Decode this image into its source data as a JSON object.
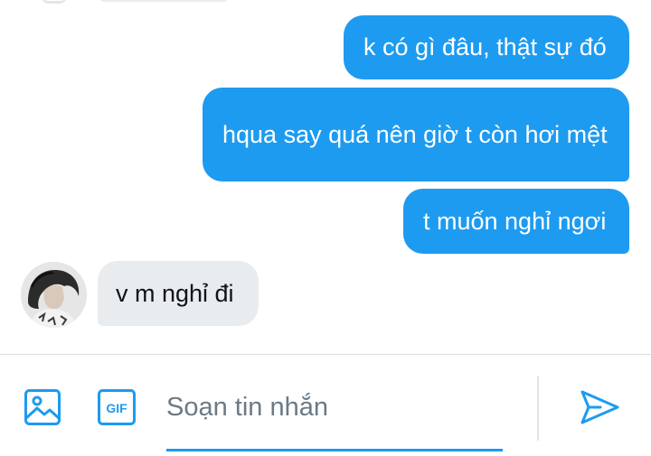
{
  "conversation": {
    "messages": [
      {
        "direction": "sent",
        "text": "k có gì đâu, thật sự đó"
      },
      {
        "direction": "sent",
        "text": "hqua say quá nên giờ t còn hơi mệt"
      },
      {
        "direction": "sent",
        "text": "t muốn nghỉ ngơi"
      },
      {
        "direction": "received",
        "text": "v m nghỉ đi"
      }
    ]
  },
  "composer": {
    "placeholder": "Soạn tin nhắn",
    "value": "",
    "icons": {
      "image": "image-icon",
      "gif": "gif-icon",
      "send": "send-icon"
    },
    "gif_label": "GIF"
  },
  "colors": {
    "accent": "#1d9bf0",
    "received_bubble": "#e9ecef",
    "received_text": "#0f1419",
    "placeholder": "#6b7a86"
  }
}
